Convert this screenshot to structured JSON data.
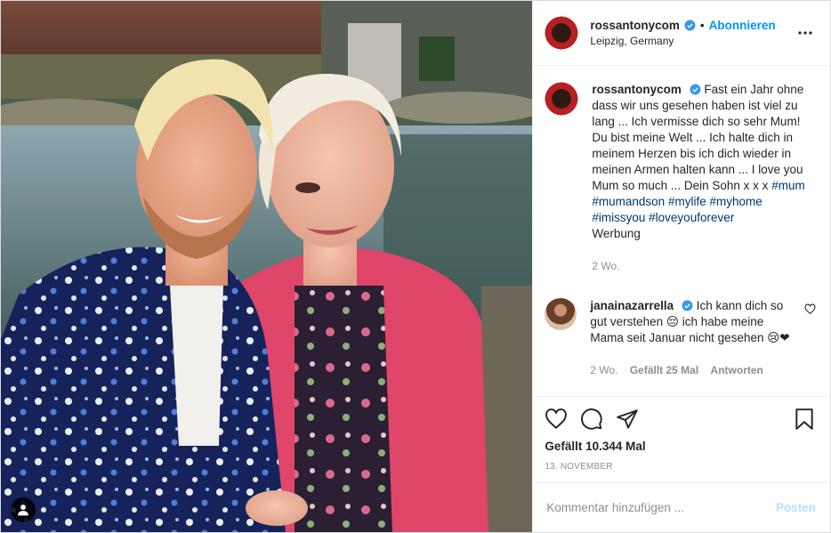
{
  "post": {
    "author": {
      "username": "rossantonycom",
      "verified": true,
      "follow_label": "Abonnieren",
      "dot": "•",
      "location": "Leipzig, Germany"
    },
    "caption": {
      "username": "rossantonycom",
      "text": "Fast ein Jahr ohne dass wir uns gesehen haben ist viel zu lang ... Ich vermisse dich so sehr Mum! Du bist meine Welt ... Ich halte dich in meinem Herzen bis ich dich wieder in meinen Armen halten kann ... I love you Mum so much ... Dein Sohn x x x",
      "hashtags": [
        "#mum",
        "#mumandson",
        "#mylife",
        "#myhome",
        "#imissyou",
        "#loveyouforever"
      ],
      "paid_label": "Werbung",
      "time": "2 Wo."
    },
    "comments": [
      {
        "username": "janainazarrella",
        "verified": true,
        "text": "Ich kann dich so gut verstehen 😔 ich habe meine Mama seit Januar nicht gesehen 😢❤",
        "time": "2 Wo.",
        "likes_label": "Gefällt 25 Mal",
        "reply_label": "Antworten"
      }
    ],
    "likes": "Gefällt 10.344 Mal",
    "date": "13. November",
    "comment_placeholder": "Kommentar hinzufügen ...",
    "post_label": "Posten"
  },
  "colors": {
    "accent": "#0095f6",
    "hashtag": "#00376b",
    "muted": "#8e8e8e",
    "post_disabled": "#b2dffc"
  },
  "icons": [
    "user-tag-icon",
    "verified-badge-icon",
    "more-options-icon",
    "heart-icon",
    "comment-icon",
    "share-icon",
    "bookmark-icon"
  ]
}
